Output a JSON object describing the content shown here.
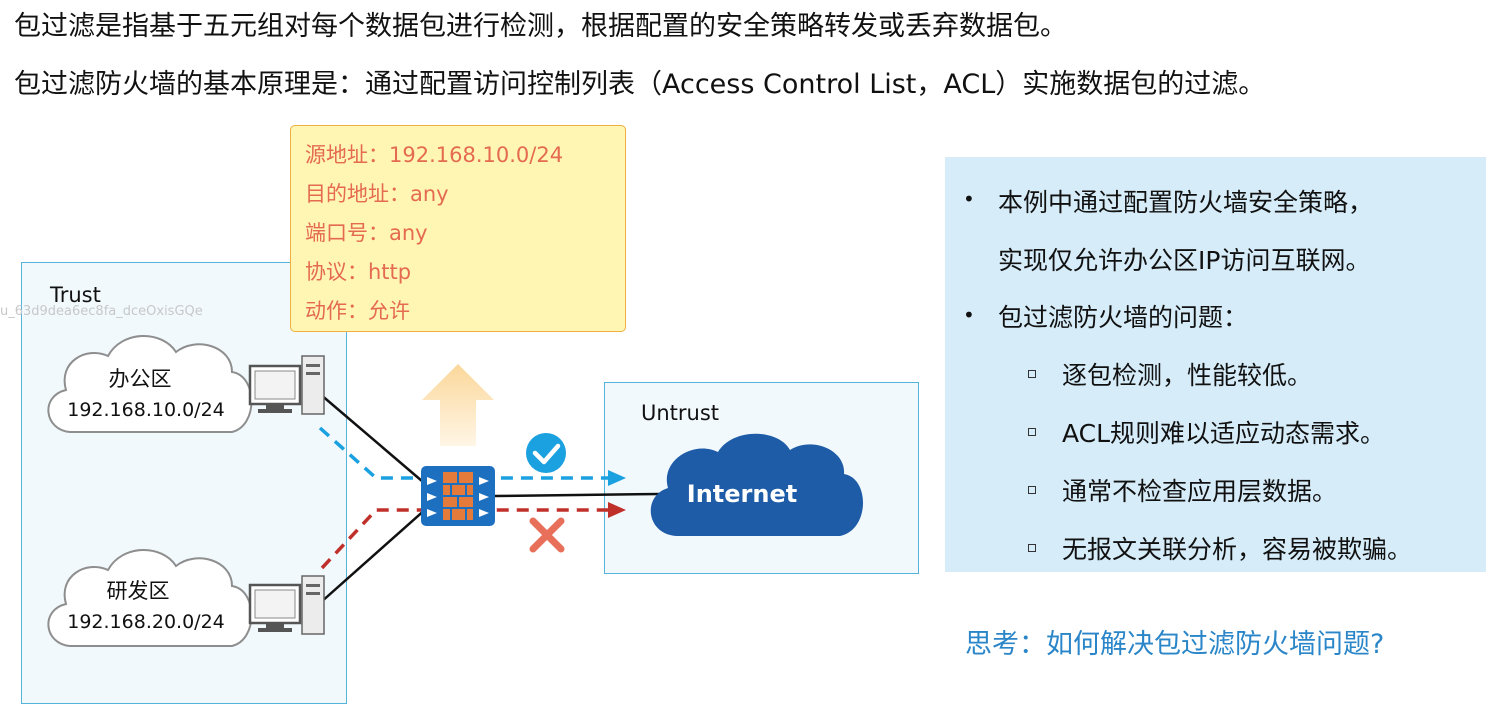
{
  "intro": {
    "line1": "包过滤是指基于五元组对每个数据包进行检测，根据配置的安全策略转发或丢弃数据包。",
    "line2": "包过滤防火墙的基本原理是：通过配置访问控制列表（Access Control List，ACL）实施数据包的过滤。"
  },
  "watermark": "u_63d9dea6ec8fa_dceOxisGQe",
  "policy": {
    "src": "源地址：192.168.10.0/24",
    "dst": "目的地址：any",
    "port": "端口号：any",
    "proto": "协议：http",
    "action": "动作：允许"
  },
  "zones": {
    "trust": "Trust",
    "untrust": "Untrust"
  },
  "office": {
    "name": "办公区",
    "subnet": "192.168.10.0/24"
  },
  "rnd": {
    "name": "研发区",
    "subnet": "192.168.20.0/24"
  },
  "internet": "Internet",
  "panel": {
    "b1_line1": "本例中通过配置防火墙安全策略，",
    "b1_line2": "实现仅允许办公区IP访问互联网。",
    "b2": "包过滤防火墙的问题：",
    "sub": [
      "逐包检测，性能较低。",
      "ACL规则难以适应动态需求。",
      "通常不检查应用层数据。",
      "无报文关联分析，容易被欺骗。"
    ]
  },
  "think": "思考：如何解决包过滤防火墙问题?",
  "colors": {
    "allow_path": "#1ba0e0",
    "deny_path": "#c0302a",
    "zone_border": "#56b4dc",
    "internet_cloud": "#1e5ca8",
    "firewall": "#1d6fc0"
  }
}
